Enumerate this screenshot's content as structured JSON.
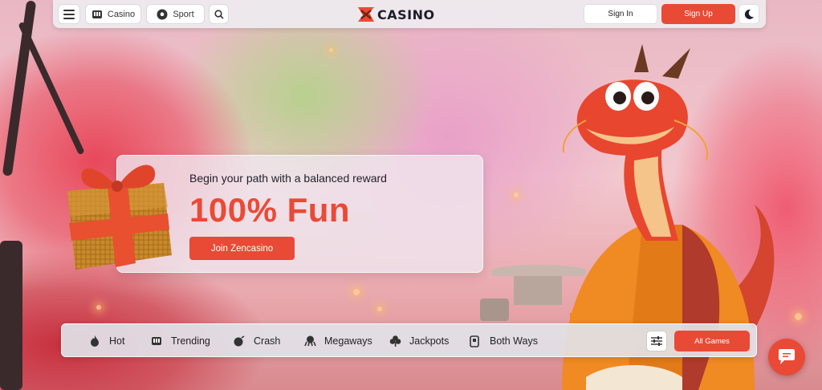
{
  "header": {
    "menu_icon": "hamburger-icon",
    "casino_label": "Casino",
    "sport_label": "Sport",
    "search_icon": "search-icon",
    "logo_text": "CASINO",
    "signin_label": "Sign In",
    "signup_label": "Sign Up",
    "theme_icon": "moon-icon"
  },
  "promo": {
    "subtitle": "Begin your path with a balanced reward",
    "headline": "100% Fun",
    "cta_label": "Join Zencasino"
  },
  "categories": {
    "items": [
      {
        "label": "Hot",
        "icon": "flame-icon"
      },
      {
        "label": "Trending",
        "icon": "slot-machine-icon"
      },
      {
        "label": "Crash",
        "icon": "bomb-icon"
      },
      {
        "label": "Megaways",
        "icon": "octopus-icon"
      },
      {
        "label": "Jackpots",
        "icon": "clover-icon"
      },
      {
        "label": "Both Ways",
        "icon": "card-icon"
      }
    ],
    "filter_icon": "sliders-icon",
    "all_games_label": "All Games"
  },
  "chat": {
    "icon": "chat-icon"
  },
  "colors": {
    "accent": "#e84a35",
    "headline": "#ea4a36",
    "header_bg": "#eeecf0"
  }
}
